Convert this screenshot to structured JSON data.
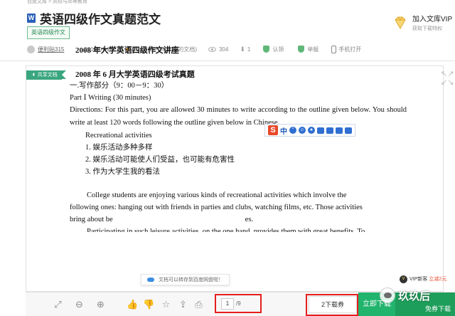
{
  "header": {
    "title": "英语四级作文真题范文",
    "file_icon": "W",
    "category_tag": "英语四级作文",
    "vip": {
      "title": "加入文库VIP",
      "subtitle": "获取下载特权"
    }
  },
  "meta": {
    "user": "便利贴315",
    "date": "2014-01-25",
    "score": "3.2分(高于34.10%的文档)",
    "views": "304",
    "downloads": "1",
    "certify": "认领",
    "report": "举报",
    "mobile": "手机打开"
  },
  "doc": {
    "share_tag": "共享文档",
    "heading1": "2008 年大学英语四级作文讲座",
    "heading2": "2008 年 6 月大学英语四级考试真题",
    "section": "一.写作部分（9：00－9：30）",
    "part": "Part Ⅰ Writing (30 minutes)",
    "directions": "Directions: For this part, you are allowed 30 minutes to write according to the outline given below. You should write at least 120 words following the outline given below in Chinese.",
    "outline_title": "Recreational activities",
    "outline_items": [
      "1. 娱乐活动多种多样",
      "2. 娱乐活动可能使人们受益，也可能有危害性",
      "3. 作为大学生我的看法"
    ],
    "para1_line1": "College students are enjoying various kinds of recreational activities which involve the",
    "para1_line2": "following ones: hanging out with friends in parties and clubs, watching films, etc. Those activities",
    "para1_line3": "bring about be",
    "para1_tail": "es.",
    "para2_line1": "Participating in such leisure activities, on the one hand, provides them with great benefits. To"
  },
  "ime": {
    "logo": "S",
    "mode": "中"
  },
  "save_tip": "文档可以转存到百度网盘啦！",
  "vip_new": {
    "text": "VIP新客",
    "promo": "立减2元"
  },
  "toolbar": {
    "page_current": "1",
    "page_total": "/9",
    "download_ticket": "2下载券",
    "download_now": "立即下载",
    "vip_free": "免券下载"
  },
  "watermark": "玖玖后",
  "colors": {
    "green": "#21b46d",
    "highlight": "#e51e1e",
    "tag_green": "#3aa680"
  }
}
